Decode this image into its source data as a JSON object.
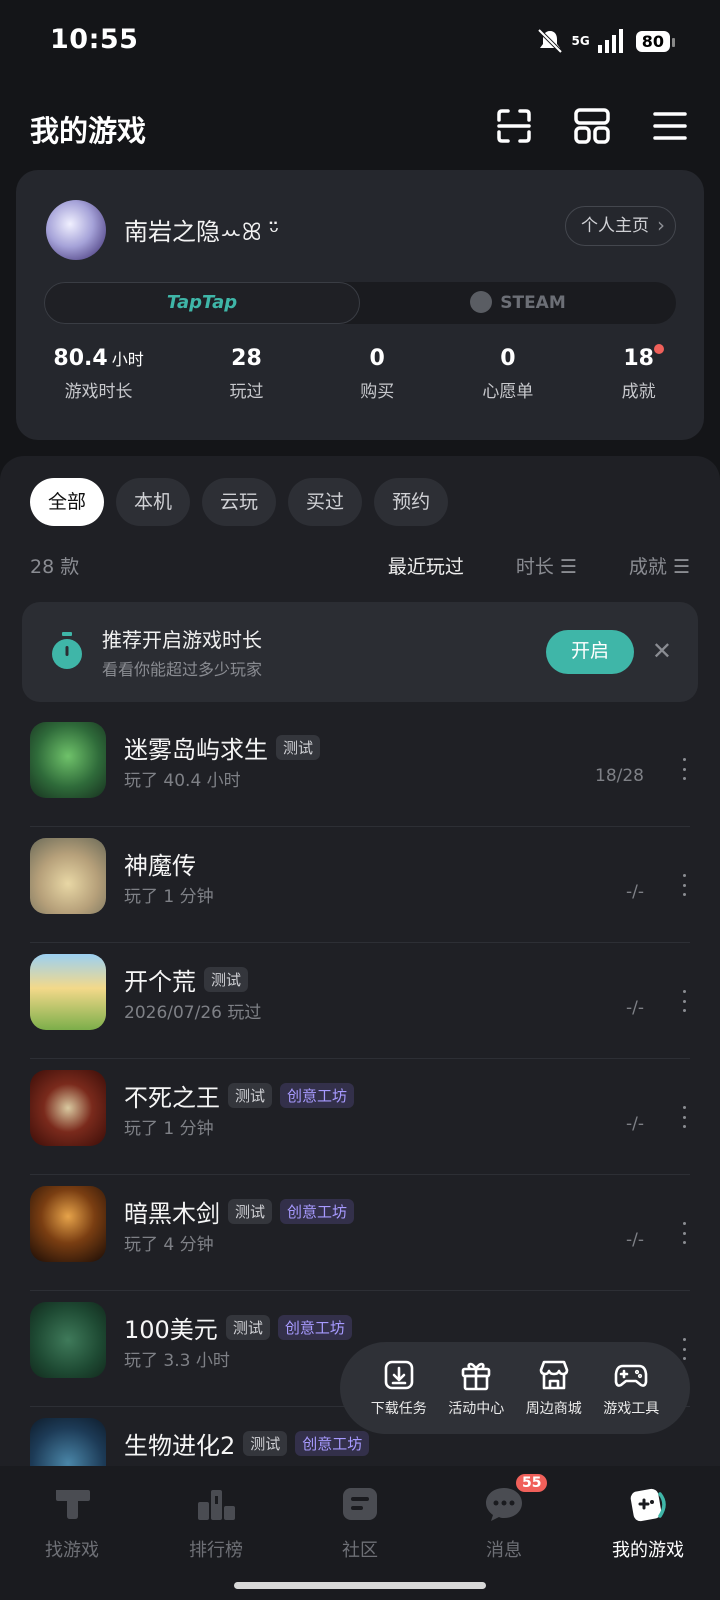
{
  "status": {
    "time": "10:55",
    "network": "5G",
    "battery": "80"
  },
  "header": {
    "title": "我的游戏",
    "icons": [
      "scan-icon",
      "grid-icon",
      "menu-icon"
    ]
  },
  "profile": {
    "username": "南岩之隐ꕀꕤ ᵕ̈",
    "homepage_label": "个人主页",
    "platforms": {
      "taptap": "TapTap",
      "steam": "STEAM"
    },
    "stats": [
      {
        "value": "80.4",
        "unit": "小时",
        "label": "游戏时长"
      },
      {
        "value": "28",
        "label": "玩过"
      },
      {
        "value": "0",
        "label": "购买"
      },
      {
        "value": "0",
        "label": "心愿单"
      },
      {
        "value": "18",
        "label": "成就"
      }
    ]
  },
  "filters": [
    "全部",
    "本机",
    "云玩",
    "买过",
    "预约"
  ],
  "list_header": {
    "count": "28 款",
    "sort": [
      "最近玩过",
      "时长 ☰",
      "成就 ☰"
    ]
  },
  "recommend": {
    "title": "推荐开启游戏时长",
    "subtitle": "看看你能超过多少玩家",
    "button": "开启",
    "close": "✕"
  },
  "games": [
    {
      "name": "迷雾岛屿求生",
      "tags": [
        "测试"
      ],
      "purple_tags": [],
      "meta": "玩了 40.4 小时",
      "progress": "18/28"
    },
    {
      "name": "神魔传",
      "tags": [],
      "purple_tags": [],
      "meta": "玩了 1 分钟",
      "progress": "-/-"
    },
    {
      "name": "开个荒",
      "tags": [
        "测试"
      ],
      "purple_tags": [],
      "meta": "2026/07/26 玩过",
      "progress": "-/-"
    },
    {
      "name": "不死之王",
      "tags": [
        "测试"
      ],
      "purple_tags": [
        "创意工坊"
      ],
      "meta": "玩了 1 分钟",
      "progress": "-/-"
    },
    {
      "name": "暗黑木剑",
      "tags": [
        "测试"
      ],
      "purple_tags": [
        "创意工坊"
      ],
      "meta": "玩了 4 分钟",
      "progress": "-/-"
    },
    {
      "name": "100美元",
      "tags": [
        "测试"
      ],
      "purple_tags": [
        "创意工坊"
      ],
      "meta": "玩了 3.3 小时",
      "progress": ""
    },
    {
      "name": "生物进化2",
      "tags": [
        "测试"
      ],
      "purple_tags": [
        "创意工坊"
      ],
      "meta": "",
      "progress": ""
    }
  ],
  "quick_tools": [
    {
      "label": "下载任务",
      "icon": "download-icon"
    },
    {
      "label": "活动中心",
      "icon": "gift-icon"
    },
    {
      "label": "周边商城",
      "icon": "shop-icon"
    },
    {
      "label": "游戏工具",
      "icon": "gamepad-icon"
    }
  ],
  "nav": [
    {
      "label": "找游戏",
      "icon": "taptap-icon"
    },
    {
      "label": "排行榜",
      "icon": "ranking-icon"
    },
    {
      "label": "社区",
      "icon": "community-icon"
    },
    {
      "label": "消息",
      "icon": "message-icon",
      "badge": "55"
    },
    {
      "label": "我的游戏",
      "icon": "my-games-icon",
      "active": true
    }
  ],
  "colors": {
    "accent": "#3fb6a8",
    "purple_tag": "#a79aff",
    "badge": "#f0605a"
  }
}
